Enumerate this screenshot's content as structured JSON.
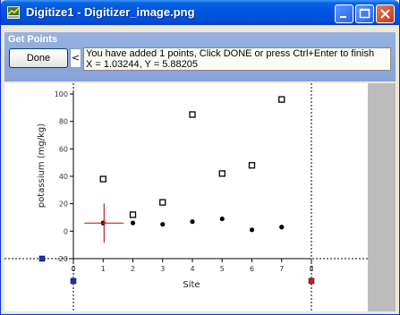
{
  "window": {
    "title": "Digitize1 - Digitizer_image.png"
  },
  "panel": {
    "title": "Get Points",
    "done_label": "Done",
    "collapse_label": "<",
    "message_line1": "You have added 1 points, Click DONE or press Ctrl+Enter to finish",
    "message_line2": "X = 1.03244, Y = 5.88205"
  },
  "chart_data": {
    "type": "scatter",
    "xlabel": "Site",
    "ylabel": "potassium (mg/kg)",
    "x_ticks": [
      "0",
      "1",
      "2",
      "3",
      "4",
      "5",
      "6",
      "7",
      "8"
    ],
    "y_ticks": [
      "100",
      "80",
      "60",
      "40",
      "20",
      "0",
      "-20"
    ],
    "xlim": [
      0,
      8
    ],
    "ylim": [
      -20,
      100
    ],
    "series": [
      {
        "marker": "open-square",
        "points": [
          [
            1,
            38
          ],
          [
            2,
            12
          ],
          [
            3,
            21
          ],
          [
            4,
            85
          ],
          [
            5,
            42
          ],
          [
            6,
            48
          ],
          [
            7,
            96
          ]
        ]
      },
      {
        "marker": "filled-circle",
        "points": [
          [
            1,
            6
          ],
          [
            2,
            6
          ],
          [
            3,
            5
          ],
          [
            4,
            7
          ],
          [
            5,
            9
          ],
          [
            6,
            1
          ],
          [
            7,
            3
          ]
        ]
      }
    ],
    "crosshair": {
      "x": 1.03244,
      "y": 5.88205,
      "color": "#cc2222"
    },
    "colors": {
      "axis_handle_blue": "#1a2fcc",
      "axis_handle_red": "#cc2020"
    }
  }
}
